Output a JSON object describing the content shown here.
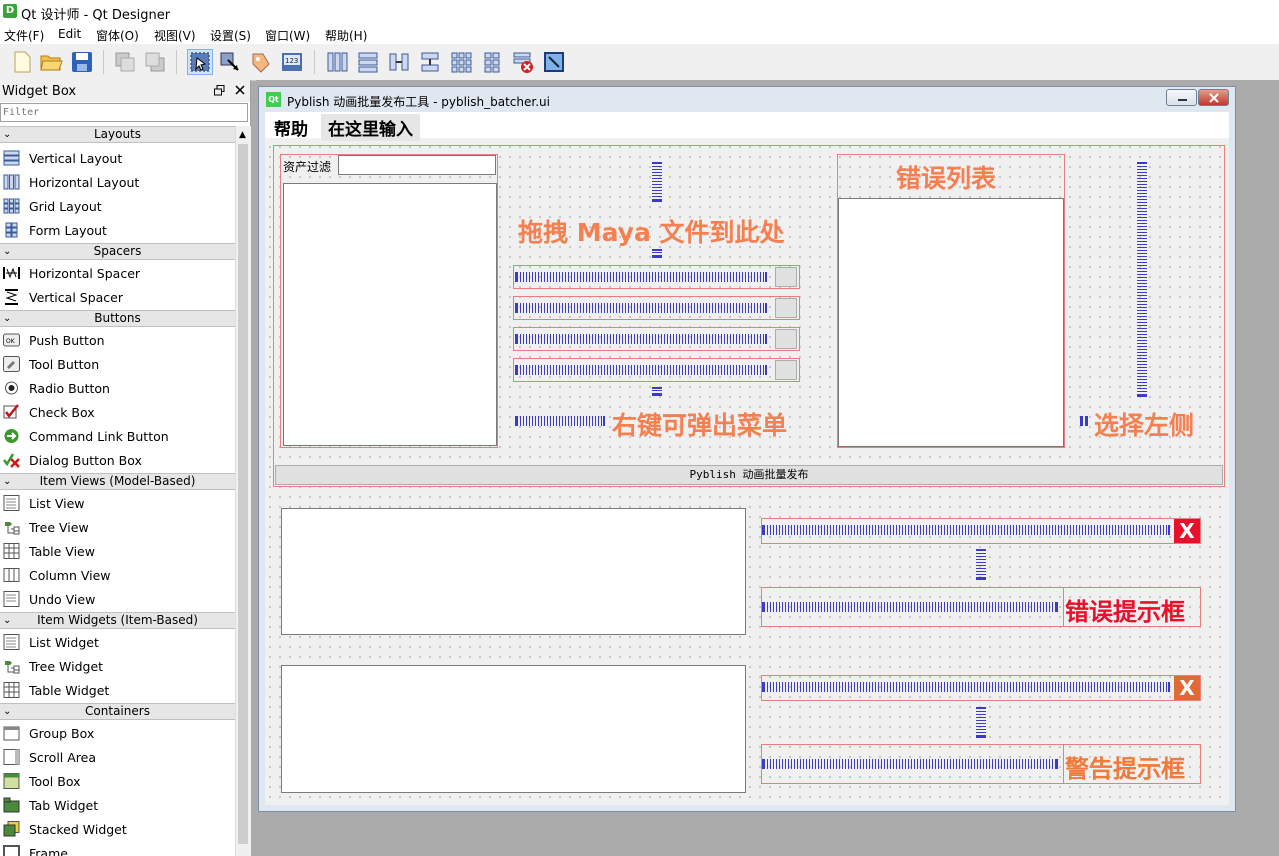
{
  "window": {
    "title": "Qt 设计师 - Qt Designer",
    "app_icon": "D"
  },
  "menubar": [
    "文件(F)",
    "Edit",
    "窗体(O)",
    "视图(V)",
    "设置(S)",
    "窗口(W)",
    "帮助(H)"
  ],
  "widget_box": {
    "title": "Widget Box",
    "filter_placeholder": "Filter",
    "categories": [
      {
        "name": "Layouts",
        "items": [
          "Vertical Layout",
          "Horizontal Layout",
          "Grid Layout",
          "Form Layout"
        ]
      },
      {
        "name": "Spacers",
        "items": [
          "Horizontal Spacer",
          "Vertical Spacer"
        ]
      },
      {
        "name": "Buttons",
        "items": [
          "Push Button",
          "Tool Button",
          "Radio Button",
          "Check Box",
          "Command Link Button",
          "Dialog Button Box"
        ]
      },
      {
        "name": "Item Views (Model-Based)",
        "items": [
          "List View",
          "Tree View",
          "Table View",
          "Column View",
          "Undo View"
        ]
      },
      {
        "name": "Item Widgets (Item-Based)",
        "items": [
          "List Widget",
          "Tree Widget",
          "Table Widget"
        ]
      },
      {
        "name": "Containers",
        "items": [
          "Group Box",
          "Scroll Area",
          "Tool Box",
          "Tab Widget",
          "Stacked Widget",
          "Frame"
        ]
      }
    ]
  },
  "form": {
    "title": "Pyblish 动画批量发布工具 - pyblish_batcher.ui",
    "qt_badge": "Qt",
    "menu": {
      "help": "帮助",
      "input": "在这里输入"
    },
    "asset_filter_label": "资产过滤",
    "drag_text": "拖拽 Maya 文件到此处",
    "right_click_text": "右键可弹出菜单",
    "error_list_title": "错误列表",
    "select_left_text": "选择左侧",
    "publish_button": "Pyblish 动画批量发布",
    "error_box_label": "错误提示框",
    "warning_box_label": "警告提示框",
    "close_glyph": "X"
  },
  "colors": {
    "accent_orange": "#f57f4f",
    "error_red": "#e8102a",
    "warning_orange": "#f07a3a",
    "spacer_blue": "#3b3bc8"
  }
}
